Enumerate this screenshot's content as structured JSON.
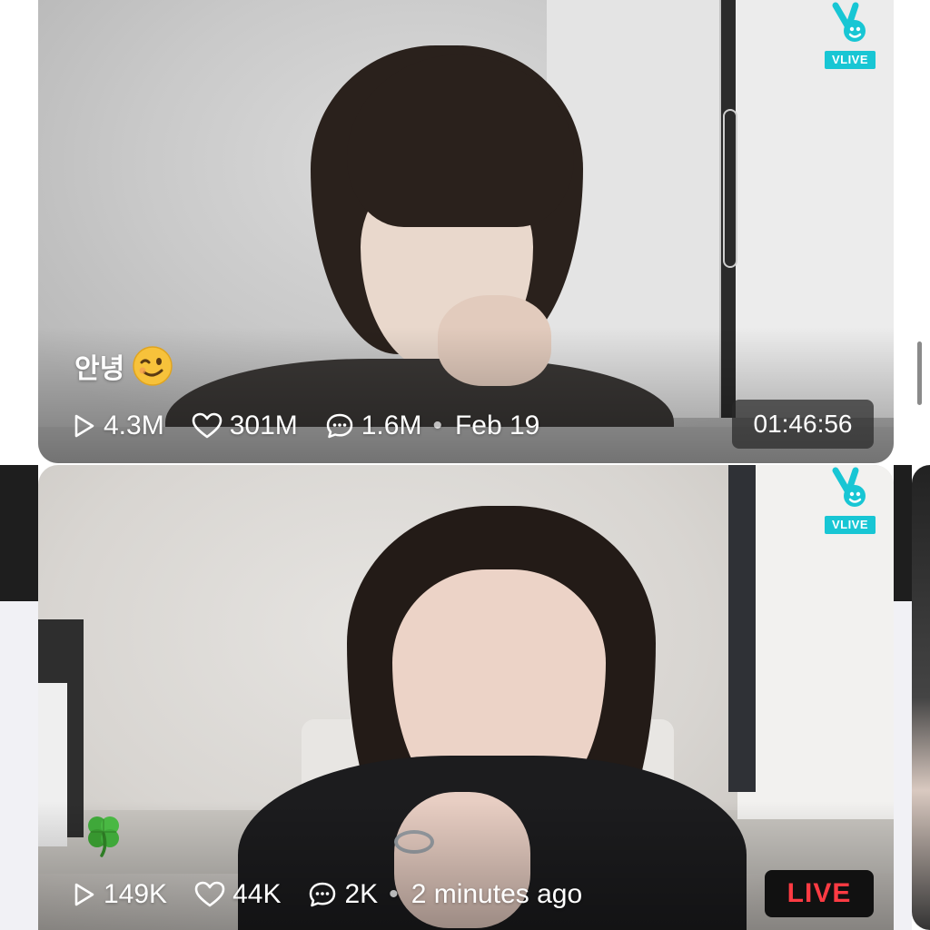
{
  "feed": {
    "videos": [
      {
        "title": "안녕",
        "title_emoji": "winking-face",
        "brand_tag": "VLIVE",
        "views": "4.3M",
        "likes": "301M",
        "comments": "1.6M",
        "separator": "•",
        "date": "Feb 19",
        "duration": "01:46:56"
      },
      {
        "title_emoji": "four-leaf-clover",
        "brand_tag": "VLIVE",
        "views": "149K",
        "likes": "44K",
        "comments": "2K",
        "separator": "•",
        "time_ago": "2 minutes ago",
        "status_badge": "LIVE",
        "status_color": "#ff3b43"
      }
    ]
  },
  "colors": {
    "vlive_cyan": "#18c6d4",
    "live_red": "#ff3b43",
    "overlay_text": "#ffffff"
  },
  "icons": {
    "views": "play-outline-icon",
    "likes": "heart-outline-icon",
    "comments": "chat-bubble-icon",
    "brand": "vlive-logo-icon"
  }
}
